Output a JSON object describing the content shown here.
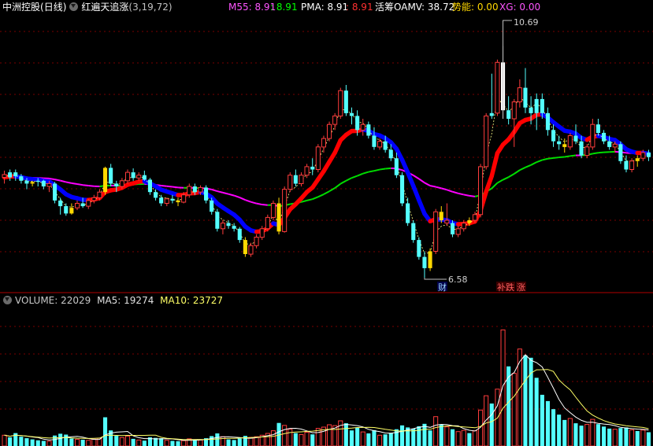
{
  "header": {
    "stock_name": "中洲控股",
    "period": "(日线)",
    "indicator_name": "红遍天追涨",
    "indicator_params": "(3,19,72)",
    "m55_label": "M55: 8.91",
    "m55_sep": ": 8.91",
    "pma_label": "PMA: 8.91",
    "pma_sep": ": 8.91",
    "oamv_label": "活筹OAMV: 38.72",
    "shineng_label": "势能: 0.00",
    "xg_label": "XG: 0.00"
  },
  "volume_header": {
    "volume_label": "VOLUME: 22029",
    "ma5_label": "MA5: 19274",
    "ma10_label": "MA10: 23727"
  },
  "annotations": {
    "high": "10.69",
    "low": "6.58",
    "cai_tag": "财",
    "pan_tag": "补跌",
    "zhang_tag": "涨"
  },
  "colors": {
    "background": "#000000",
    "grid": "#7a0000",
    "up": "#ff3c3c",
    "down": "#54ffff",
    "yellow_candle": "#ffd800",
    "white_candle": "#ffffff",
    "band_red": "#ff0000",
    "band_blue": "#0000ff",
    "ma_magenta": "#ff00ff",
    "ma_green": "#00dd00",
    "ma_yellow": "#ffff66",
    "ma_white": "#ffffff",
    "m55": "#ff55ff",
    "oamv": "#ffffff",
    "shineng": "#ffd800",
    "xg": "#ff55ff"
  },
  "chart_data": {
    "type": "candlestick",
    "ylim": [
      6.4,
      11.2
    ],
    "volume_ylim": [
      0,
      46000
    ],
    "candles": [
      [
        8.41,
        8.48,
        8.25,
        8.36,
        "up",
        3600
      ],
      [
        8.36,
        8.5,
        8.3,
        8.45,
        "down",
        2900
      ],
      [
        8.45,
        8.5,
        8.3,
        8.38,
        "down",
        4300
      ],
      [
        8.38,
        8.42,
        8.25,
        8.3,
        "down",
        3100
      ],
      [
        8.3,
        8.35,
        8.15,
        8.25,
        "down",
        2600
      ],
      [
        8.25,
        8.3,
        8.2,
        8.28,
        "yellow",
        2200
      ],
      [
        8.28,
        8.35,
        8.2,
        8.3,
        "down",
        1900
      ],
      [
        8.3,
        8.32,
        8.15,
        8.2,
        "down",
        1700
      ],
      [
        8.2,
        8.3,
        8.1,
        8.25,
        "up",
        1600
      ],
      [
        8.25,
        8.28,
        7.9,
        7.95,
        "down",
        3500
      ],
      [
        7.95,
        8.0,
        7.7,
        7.85,
        "down",
        4100
      ],
      [
        7.85,
        7.9,
        7.68,
        7.72,
        "down",
        3800
      ],
      [
        7.72,
        7.9,
        7.7,
        7.82,
        "yellow",
        2500
      ],
      [
        7.82,
        7.95,
        7.78,
        7.9,
        "up",
        2200
      ],
      [
        7.9,
        8.0,
        7.82,
        7.85,
        "down",
        2100
      ],
      [
        7.85,
        7.98,
        7.8,
        7.95,
        "up",
        1900
      ],
      [
        7.95,
        8.05,
        7.9,
        8.0,
        "up",
        2300
      ],
      [
        8.0,
        8.15,
        7.95,
        8.1,
        "up",
        2600
      ],
      [
        8.1,
        8.55,
        8.05,
        8.53,
        "yellow",
        9600
      ],
      [
        8.53,
        8.6,
        8.2,
        8.25,
        "down",
        5200
      ],
      [
        8.25,
        8.3,
        8.1,
        8.2,
        "down",
        3400
      ],
      [
        8.2,
        8.35,
        8.15,
        8.3,
        "up",
        2800
      ],
      [
        8.3,
        8.5,
        8.25,
        8.45,
        "up",
        3300
      ],
      [
        8.45,
        8.52,
        8.3,
        8.35,
        "down",
        2400
      ],
      [
        8.35,
        8.45,
        8.3,
        8.4,
        "up",
        2000
      ],
      [
        8.4,
        8.48,
        8.3,
        8.32,
        "down",
        1800
      ],
      [
        8.32,
        8.35,
        8.05,
        8.1,
        "down",
        2900
      ],
      [
        8.1,
        8.15,
        7.95,
        8.0,
        "down",
        2700
      ],
      [
        8.0,
        8.05,
        7.85,
        7.9,
        "down",
        2600
      ],
      [
        7.9,
        8.0,
        7.85,
        7.98,
        "up",
        1900
      ],
      [
        7.98,
        8.05,
        7.9,
        7.95,
        "down",
        1700
      ],
      [
        7.95,
        8.0,
        7.85,
        7.92,
        "yellow",
        1600
      ],
      [
        7.92,
        8.1,
        7.9,
        8.05,
        "up",
        1800
      ],
      [
        8.05,
        8.25,
        8.0,
        8.2,
        "up",
        2400
      ],
      [
        8.2,
        8.25,
        8.05,
        8.1,
        "down",
        2200
      ],
      [
        8.1,
        8.22,
        8.05,
        8.18,
        "up",
        2000
      ],
      [
        8.18,
        8.22,
        7.9,
        7.95,
        "down",
        2600
      ],
      [
        7.95,
        8.0,
        7.7,
        7.75,
        "down",
        3300
      ],
      [
        7.75,
        7.8,
        7.4,
        7.45,
        "down",
        4200
      ],
      [
        7.45,
        7.6,
        7.35,
        7.55,
        "up",
        3100
      ],
      [
        7.55,
        7.6,
        7.45,
        7.5,
        "down",
        2200
      ],
      [
        7.5,
        7.55,
        7.4,
        7.45,
        "down",
        2000
      ],
      [
        7.45,
        7.48,
        7.2,
        7.25,
        "down",
        2500
      ],
      [
        7.25,
        7.3,
        6.95,
        7.0,
        "yellow",
        3400
      ],
      [
        7.0,
        7.2,
        6.95,
        7.15,
        "up",
        2900
      ],
      [
        7.15,
        7.35,
        7.1,
        7.3,
        "up",
        3100
      ],
      [
        7.3,
        7.5,
        7.25,
        7.45,
        "up",
        3600
      ],
      [
        7.45,
        7.7,
        7.4,
        7.65,
        "up",
        4200
      ],
      [
        7.65,
        7.95,
        7.6,
        7.9,
        "up",
        5100
      ],
      [
        7.9,
        8.0,
        7.35,
        7.4,
        "yellow",
        7700
      ],
      [
        7.4,
        8.2,
        7.38,
        8.15,
        "up",
        6900
      ],
      [
        8.15,
        8.45,
        8.1,
        8.4,
        "up",
        5600
      ],
      [
        8.4,
        8.5,
        8.2,
        8.25,
        "down",
        4300
      ],
      [
        8.25,
        8.45,
        8.2,
        8.4,
        "up",
        3800
      ],
      [
        8.4,
        8.6,
        8.35,
        8.55,
        "up",
        4600
      ],
      [
        8.55,
        8.7,
        8.4,
        8.5,
        "down",
        3900
      ],
      [
        8.5,
        8.95,
        8.45,
        8.9,
        "up",
        5900
      ],
      [
        8.9,
        9.1,
        8.8,
        9.05,
        "up",
        6300
      ],
      [
        9.05,
        9.35,
        9.0,
        9.3,
        "up",
        7100
      ],
      [
        9.3,
        9.5,
        9.2,
        9.45,
        "up",
        6800
      ],
      [
        9.45,
        9.95,
        9.4,
        9.9,
        "up",
        8400
      ],
      [
        9.9,
        10.0,
        9.45,
        9.5,
        "down",
        7600
      ],
      [
        9.5,
        9.6,
        9.3,
        9.45,
        "down",
        5200
      ],
      [
        9.45,
        9.55,
        9.1,
        9.2,
        "down",
        6100
      ],
      [
        9.2,
        9.4,
        9.1,
        9.3,
        "up",
        4700
      ],
      [
        9.3,
        9.35,
        9.05,
        9.1,
        "down",
        4200
      ],
      [
        9.1,
        9.25,
        8.85,
        8.9,
        "down",
        5300
      ],
      [
        8.9,
        9.05,
        8.85,
        9.0,
        "up",
        3600
      ],
      [
        9.0,
        9.1,
        8.8,
        8.85,
        "down",
        3900
      ],
      [
        8.85,
        8.95,
        8.65,
        8.7,
        "down",
        4400
      ],
      [
        8.7,
        8.8,
        8.35,
        8.4,
        "down",
        5600
      ],
      [
        8.4,
        8.45,
        7.85,
        7.9,
        "down",
        6900
      ],
      [
        7.9,
        8.0,
        7.5,
        7.55,
        "down",
        6200
      ],
      [
        7.55,
        7.6,
        7.2,
        7.25,
        "down",
        5800
      ],
      [
        7.25,
        7.3,
        6.9,
        6.95,
        "down",
        6600
      ],
      [
        6.95,
        7.05,
        6.58,
        6.75,
        "down",
        7400
      ],
      [
        6.75,
        7.1,
        6.7,
        7.05,
        "yellow",
        5200
      ],
      [
        7.05,
        7.8,
        7.0,
        7.75,
        "up",
        9800
      ],
      [
        7.75,
        7.85,
        7.55,
        7.6,
        "yellow",
        7100
      ],
      [
        7.6,
        7.9,
        7.5,
        7.55,
        "up",
        6400
      ],
      [
        7.55,
        7.6,
        7.3,
        7.35,
        "down",
        5600
      ],
      [
        7.35,
        7.5,
        7.3,
        7.45,
        "up",
        4800
      ],
      [
        7.45,
        7.6,
        7.4,
        7.55,
        "up",
        5200
      ],
      [
        7.55,
        7.65,
        7.5,
        7.6,
        "yellow",
        4300
      ],
      [
        7.6,
        7.75,
        7.55,
        7.7,
        "up",
        5100
      ],
      [
        7.7,
        8.6,
        7.65,
        8.55,
        "up",
        12000
      ],
      [
        8.55,
        9.5,
        8.5,
        9.45,
        "up",
        16800
      ],
      [
        9.45,
        10.2,
        9.4,
        9.5,
        "down",
        14200
      ],
      [
        9.5,
        10.45,
        9.45,
        10.4,
        "up",
        19000
      ],
      [
        10.4,
        10.69,
        9.4,
        9.55,
        "white",
        38800
      ],
      [
        9.55,
        9.8,
        9.3,
        9.4,
        "down",
        26600
      ],
      [
        9.4,
        9.75,
        8.9,
        9.7,
        "up",
        24300
      ],
      [
        9.7,
        10.1,
        9.6,
        9.95,
        "up",
        32400
      ],
      [
        9.95,
        10.3,
        9.5,
        9.6,
        "down",
        30300
      ],
      [
        9.6,
        9.8,
        9.3,
        9.5,
        "down",
        29500
      ],
      [
        9.5,
        9.85,
        9.2,
        9.75,
        "down",
        22800
      ],
      [
        9.75,
        9.85,
        9.4,
        9.5,
        "down",
        17100
      ],
      [
        9.5,
        9.6,
        9.1,
        9.2,
        "down",
        15000
      ],
      [
        9.2,
        9.3,
        8.9,
        9.0,
        "down",
        12300
      ],
      [
        9.0,
        9.1,
        8.85,
        8.95,
        "down",
        10500
      ],
      [
        8.95,
        9.05,
        8.8,
        8.9,
        "yellow",
        8700
      ],
      [
        8.9,
        9.15,
        8.85,
        9.1,
        "up",
        9200
      ],
      [
        9.1,
        9.3,
        8.95,
        9.0,
        "down",
        7600
      ],
      [
        9.0,
        9.1,
        8.7,
        8.75,
        "down",
        6800
      ],
      [
        8.75,
        8.95,
        8.7,
        8.9,
        "up",
        7200
      ],
      [
        8.9,
        9.4,
        8.85,
        9.3,
        "up",
        8900
      ],
      [
        9.3,
        9.4,
        9.1,
        9.15,
        "down",
        7300
      ],
      [
        9.15,
        9.2,
        8.95,
        9.0,
        "down",
        6500
      ],
      [
        9.0,
        9.1,
        8.85,
        8.9,
        "down",
        5800
      ],
      [
        8.9,
        9.0,
        8.8,
        8.95,
        "up",
        5600
      ],
      [
        8.95,
        9.0,
        8.6,
        8.65,
        "down",
        6000
      ],
      [
        8.65,
        8.75,
        8.45,
        8.5,
        "down",
        6200
      ],
      [
        8.5,
        8.7,
        8.45,
        8.65,
        "up",
        5400
      ],
      [
        8.65,
        8.75,
        8.55,
        8.7,
        "yellow",
        5000
      ],
      [
        8.7,
        8.85,
        8.65,
        8.8,
        "up",
        5300
      ],
      [
        8.8,
        8.85,
        8.65,
        8.72,
        "down",
        4600
      ]
    ],
    "high_index": 89,
    "low_index": 75
  }
}
